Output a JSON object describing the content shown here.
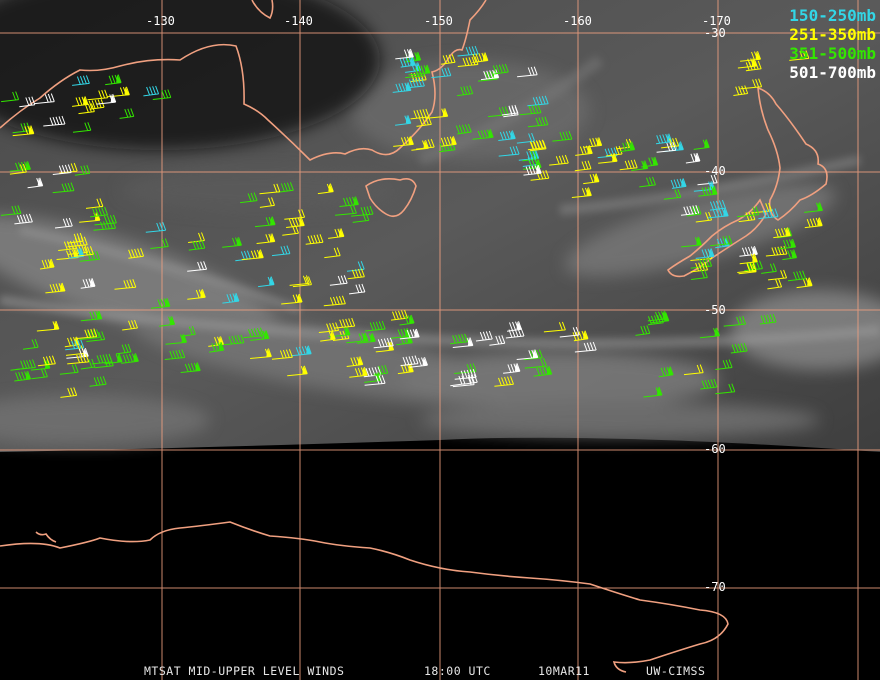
{
  "legend": {
    "items": [
      {
        "label": "150-250mb",
        "color": "#33d6e6"
      },
      {
        "label": "251-350mb",
        "color": "#ffff00"
      },
      {
        "label": "351-500mb",
        "color": "#33e600"
      },
      {
        "label": "501-700mb",
        "color": "#ffffff"
      }
    ]
  },
  "grid": {
    "longitudes": [
      "-130",
      "-140",
      "-150",
      "-160",
      "-170"
    ],
    "latitudes": [
      "-30",
      "-40",
      "-50",
      "-60",
      "-70"
    ]
  },
  "footer": {
    "product": "MTSAT MID-UPPER LEVEL WINDS",
    "time": "18:00 UTC",
    "date": "10MAR11",
    "credit": "UW-CIMSS"
  },
  "colors": {
    "coastline": "#f0a080",
    "gridline": "#f0a080",
    "space": "#000000"
  }
}
